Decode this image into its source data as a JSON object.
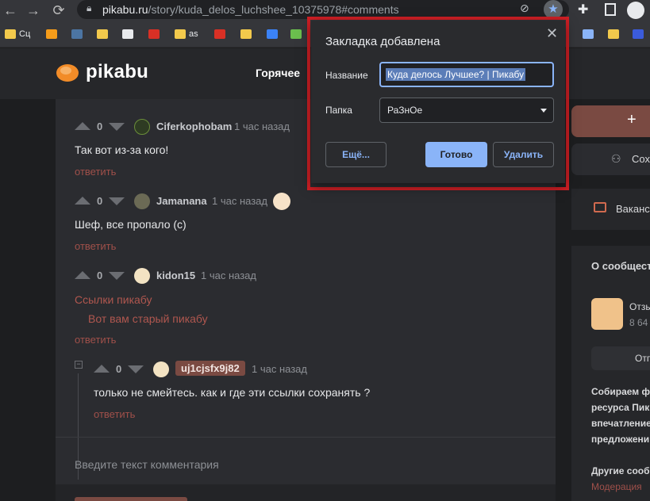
{
  "browser": {
    "url_host": "pikabu.ru",
    "url_path": "/story/kuda_delos_luchshee_10375978#comments",
    "bookmarks": [
      {
        "label": "Сц",
        "color": "#f2c94c"
      },
      {
        "label": "",
        "color": "#f59c1a"
      },
      {
        "label": "",
        "color": "#4c75a3"
      },
      {
        "label": "",
        "color": "#f2c94c"
      },
      {
        "label": "",
        "color": "#e8eaed"
      },
      {
        "label": "",
        "color": "#d93025"
      },
      {
        "label": "as",
        "color": "#f2c94c"
      },
      {
        "label": "",
        "color": "#d93025"
      },
      {
        "label": "",
        "color": "#f2c94c"
      }
    ]
  },
  "site": {
    "logo": "pikabu",
    "nav_hot": "Горячее",
    "brand_color": "#f28c28"
  },
  "comments": [
    {
      "score": "0",
      "author": "Ciferkophobam",
      "time": "1 час назад",
      "text": "Так вот из-за кого!",
      "reply": "ответить"
    },
    {
      "score": "0",
      "author": "Jamanana",
      "time": "1 час назад",
      "text": "Шеф, все пропало (с)",
      "reply": "ответить"
    },
    {
      "score": "0",
      "author": "kidon15",
      "time": "1 час назад",
      "link1": "Ссылки пикабу",
      "link2": "Вот вам старый пикабу",
      "reply": "ответить"
    },
    {
      "score": "0",
      "author": "uj1cjsfx9j82",
      "time": "1 час назад",
      "text": "только не смейтесь. как и где эти ссылки сохранять ?",
      "reply": "ответить"
    }
  ],
  "comment_input": {
    "placeholder": "Введите текст комментария"
  },
  "sidebar": {
    "subs": "Сох",
    "jobs": "Ваканс",
    "about_title": "О сообщест",
    "community_name": "Отзы",
    "community_count": "8 64",
    "community_btn": "Отп",
    "desc_lines": [
      "Собираем ф",
      "ресурса Пик",
      "впечатление",
      "предложени"
    ],
    "other": "Другие сооб",
    "moderation": "Модерация"
  },
  "dialog": {
    "title": "Закладка добавлена",
    "name_label": "Название",
    "name_value": "Куда делось Лучшее? | Пикабу",
    "folder_label": "Папка",
    "folder_value": "РаЗнОе",
    "more_label": "Ещё...",
    "done_label": "Готово",
    "remove_label": "Удалить"
  }
}
